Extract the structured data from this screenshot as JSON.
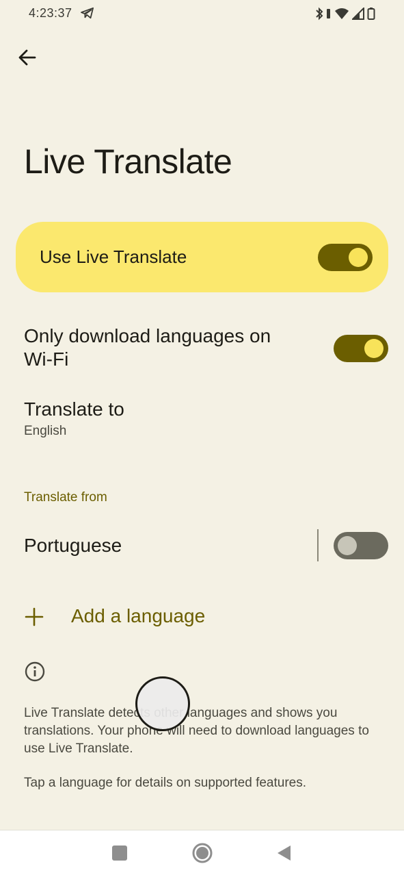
{
  "status_bar": {
    "time": "4:23:37",
    "icons": [
      "telegram-icon",
      "bluetooth-icon",
      "vibrate-icon",
      "wifi-icon",
      "signal-icon",
      "battery-icon"
    ]
  },
  "header": {
    "back_icon": "arrow-back-icon",
    "title": "Live Translate"
  },
  "main_toggle": {
    "label": "Use Live Translate",
    "enabled": true
  },
  "settings": {
    "wifi_only": {
      "label": "Only download languages on Wi-Fi",
      "enabled": true
    },
    "translate_to": {
      "label": "Translate to",
      "value": "English"
    },
    "translate_from_header": "Translate from",
    "languages": [
      {
        "label": "Portuguese",
        "enabled": false
      }
    ],
    "add_language_label": "Add a language"
  },
  "info": {
    "icon": "info-icon",
    "paragraph1": "Live Translate detects other languages and shows you translations. Your phone will need to download languages to use Live Translate.",
    "paragraph2": "Tap a language for details on supported features."
  },
  "colors": {
    "background": "#f4f1e4",
    "accent": "#6b5e00",
    "card": "#fbe86e",
    "toggle_knob_on": "#f8e35a"
  },
  "nav_bar": {
    "buttons": [
      "recents-button",
      "home-button",
      "back-button"
    ]
  }
}
